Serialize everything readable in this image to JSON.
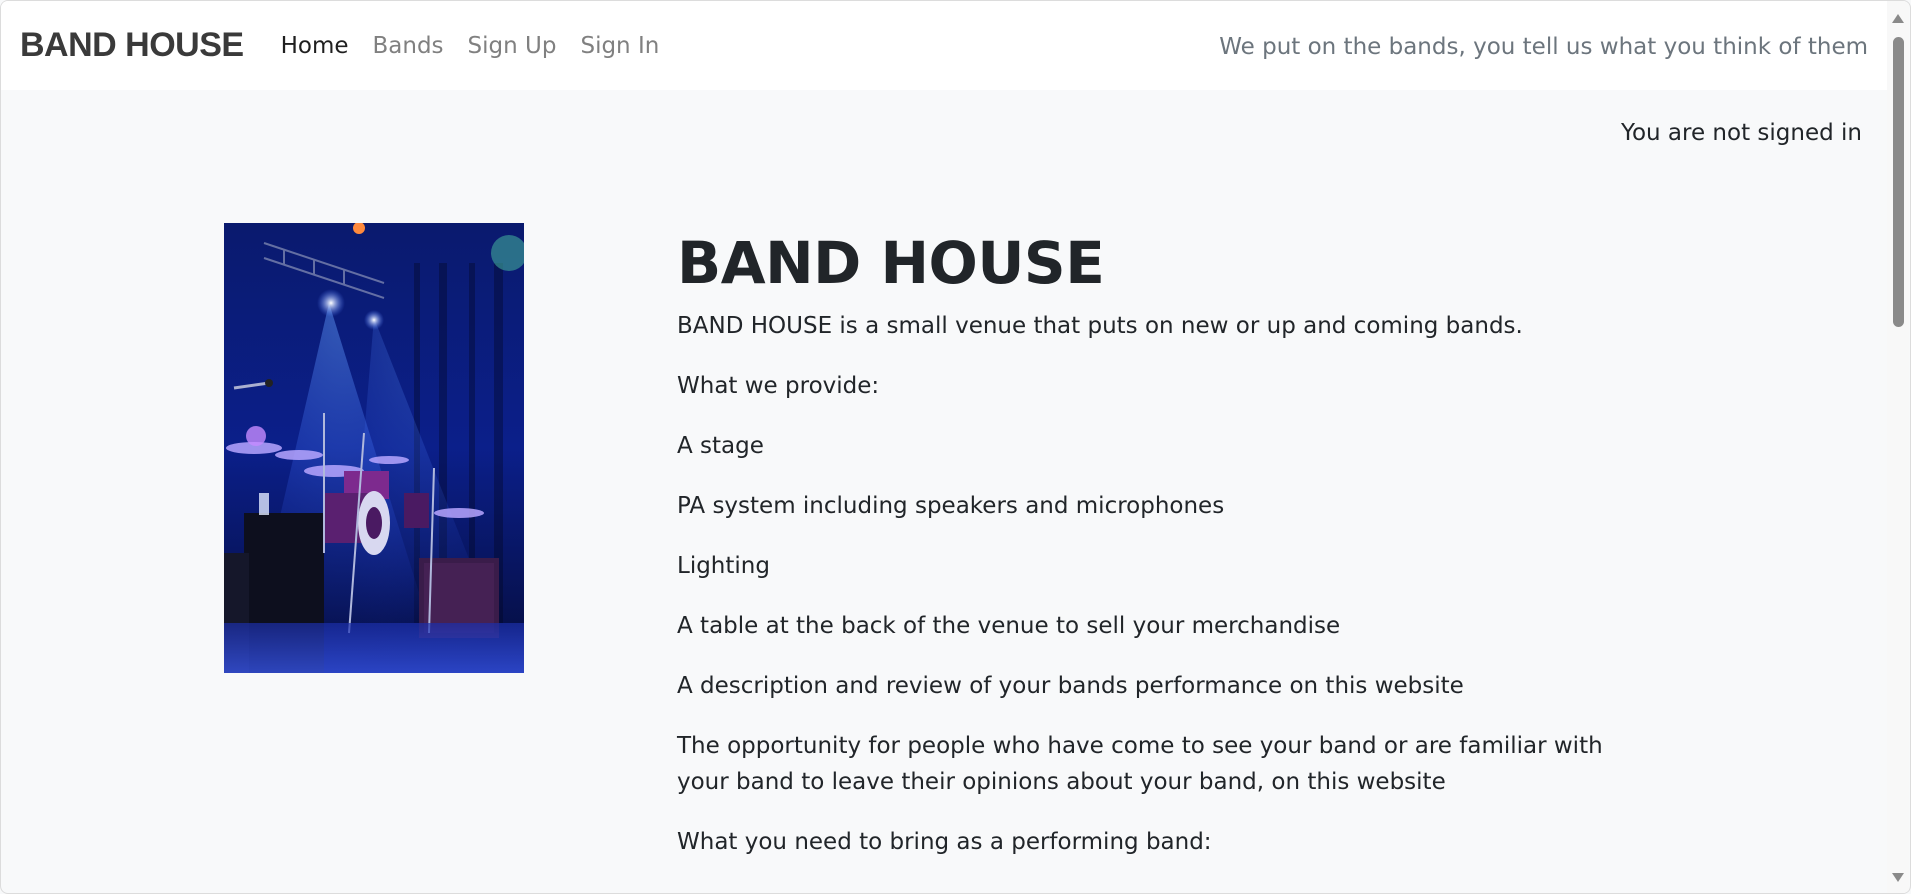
{
  "navbar": {
    "brand": "BAND HOUSE",
    "links": [
      "Home",
      "Bands",
      "Sign Up",
      "Sign In"
    ],
    "tagline": "We put on the bands, you tell us what you think of them"
  },
  "status": {
    "signin": "You are not signed in"
  },
  "main": {
    "title": "BAND HOUSE",
    "paragraphs": [
      "BAND HOUSE is a small venue that puts on new or up and coming bands.",
      "What we provide:",
      "A stage",
      "PA system including speakers and microphones",
      "Lighting",
      "A table at the back of the venue to sell your merchandise",
      "A description and review of your bands performance on this website",
      "The opportunity for people who have come to see your band or are familiar with your band to leave their opinions about your band, on this website",
      "What you need to bring as a performing band:"
    ]
  },
  "colors": {
    "navbar_bg": "#ffffff",
    "page_bg": "#f8f9fa",
    "nav_active": "#1f1f1f",
    "nav_inactive": "#808080"
  }
}
